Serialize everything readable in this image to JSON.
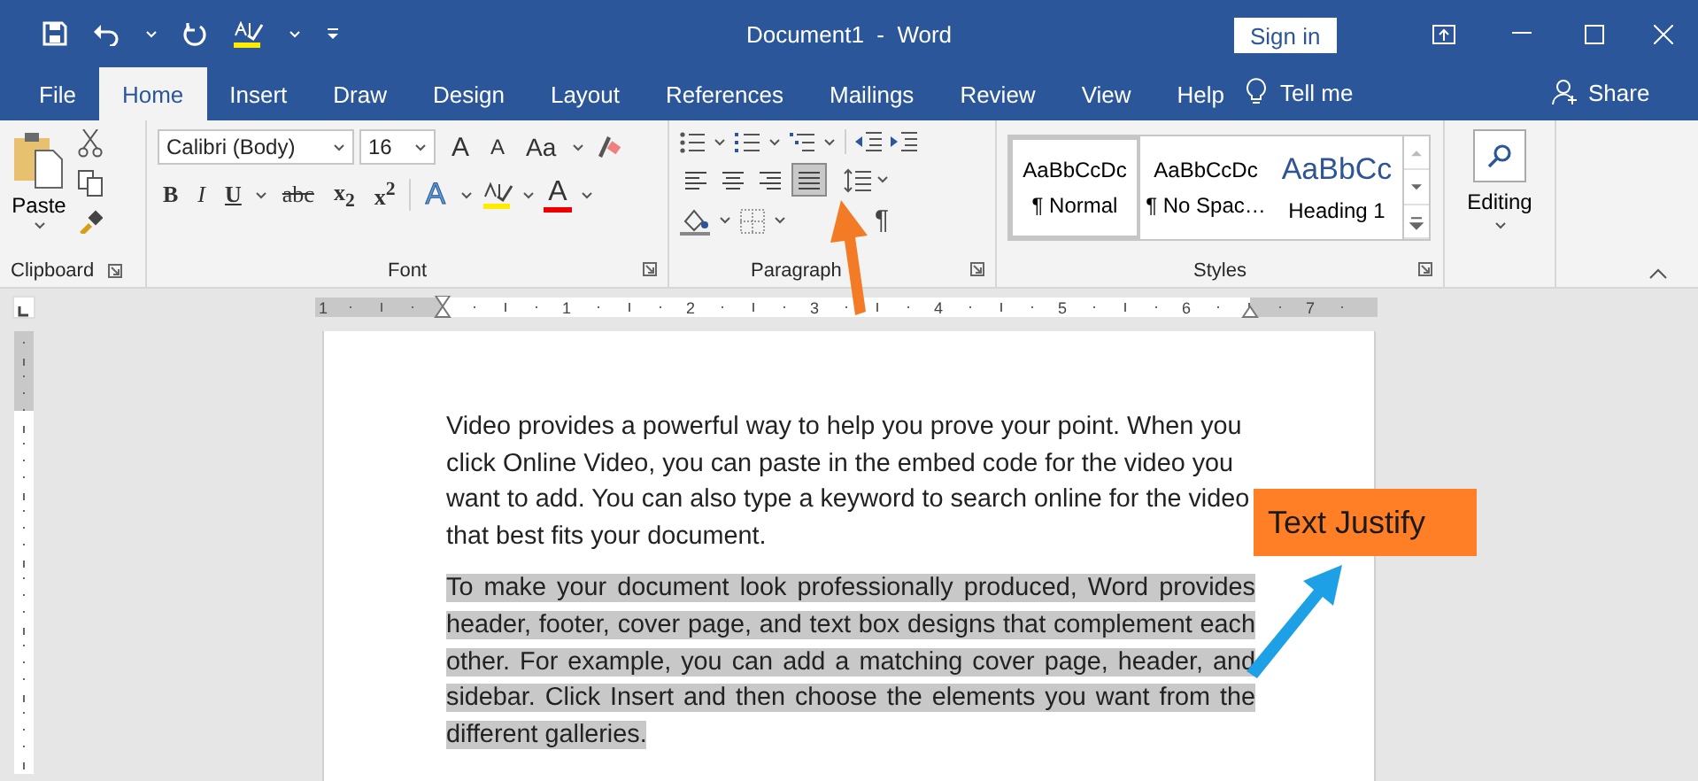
{
  "window": {
    "title": "Document1  -  Word",
    "sign_in": "Sign in"
  },
  "tabs": [
    {
      "label": "File",
      "selected": false
    },
    {
      "label": "Home",
      "selected": true
    },
    {
      "label": "Insert",
      "selected": false
    },
    {
      "label": "Draw",
      "selected": false
    },
    {
      "label": "Design",
      "selected": false
    },
    {
      "label": "Layout",
      "selected": false
    },
    {
      "label": "References",
      "selected": false
    },
    {
      "label": "Mailings",
      "selected": false
    },
    {
      "label": "Review",
      "selected": false
    },
    {
      "label": "View",
      "selected": false
    },
    {
      "label": "Help",
      "selected": false
    }
  ],
  "tell_me": "Tell me",
  "share": "Share",
  "ribbon": {
    "clipboard": {
      "paste": "Paste",
      "label": "Clipboard"
    },
    "font": {
      "name": "Calibri (Body)",
      "size": "16",
      "grow": "A",
      "shrink": "A",
      "change_case": "Aa",
      "label": "Font",
      "format_buttons": [
        {
          "label": "B",
          "kind": "bold"
        },
        {
          "label": "I",
          "kind": "italic"
        },
        {
          "label": "U",
          "kind": "underline"
        },
        {
          "label": "abc",
          "kind": "strike"
        },
        {
          "label": "x$_{2}$",
          "kind": "sub"
        },
        {
          "label": "x$^{2}$",
          "kind": "sup"
        }
      ],
      "effects": "A",
      "font_color": "A"
    },
    "paragraph": {
      "label": "Paragraph",
      "pilcrow": "¶",
      "align": [
        {
          "kind": "left",
          "selected": false
        },
        {
          "kind": "center",
          "selected": false
        },
        {
          "kind": "right",
          "selected": false
        },
        {
          "kind": "justify",
          "selected": true
        }
      ]
    },
    "styles": {
      "label": "Styles",
      "items": [
        {
          "preview": "AaBbCcDc",
          "name": "¶ Normal",
          "selected": true,
          "kind": "body"
        },
        {
          "preview": "AaBbCcDc",
          "name": "¶ No Spac…",
          "selected": false,
          "kind": "body"
        },
        {
          "preview": "AaBbCc",
          "name": "Heading 1",
          "selected": false,
          "kind": "heading"
        }
      ]
    },
    "editing": {
      "label": "Editing"
    }
  },
  "ruler": {
    "numbers": [
      "1",
      "1",
      "2",
      "3",
      "4",
      "5",
      "6",
      "7"
    ]
  },
  "document": {
    "paragraphs": [
      {
        "text": "Video provides a powerful way to help you prove your point. When you click Online Video, you can paste in the embed code for the video you want to add. You can also type a keyword to search online for the video that best fits your document.",
        "selected": false,
        "justified": false
      },
      {
        "text": "To make your document look professionally produced, Word provides header, footer, cover page, and text box designs that complement each other. For example, you can add a matching cover page, header, and sidebar. Click Insert and then choose the elements you want from the different galleries.",
        "selected": true,
        "justified": true
      }
    ]
  },
  "callout": {
    "text": "Text Justify"
  }
}
